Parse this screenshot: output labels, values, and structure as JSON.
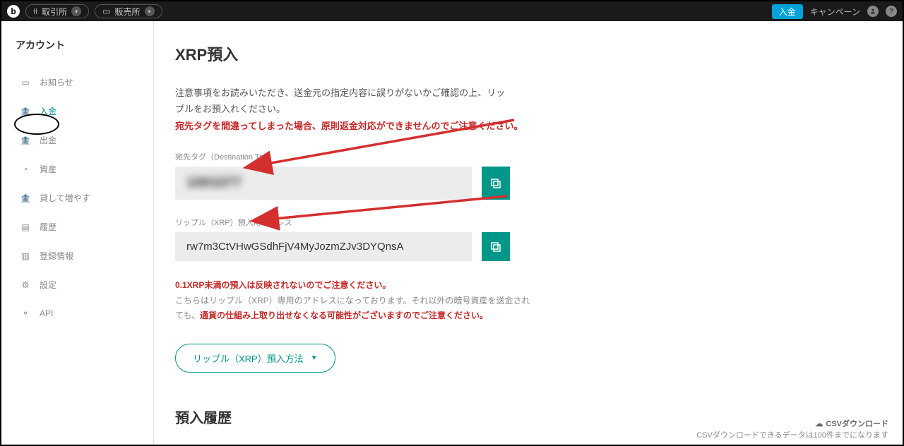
{
  "topbar": {
    "exchange_label": "取引所",
    "store_label": "販売所",
    "deposit_button": "入金",
    "campaign_link": "キャンペーン"
  },
  "sidebar": {
    "title": "アカウント",
    "items": [
      {
        "icon": "message",
        "label": "お知らせ"
      },
      {
        "icon": "bank",
        "label": "入金",
        "active": true
      },
      {
        "icon": "bank-out",
        "label": "出金"
      },
      {
        "icon": "pie",
        "label": "資産"
      },
      {
        "icon": "bank-plus",
        "label": "貸して増やす"
      },
      {
        "icon": "doc",
        "label": "履歴"
      },
      {
        "icon": "reg",
        "label": "登録情報"
      },
      {
        "icon": "gear",
        "label": "設定"
      },
      {
        "icon": "api",
        "label": "API"
      }
    ]
  },
  "main": {
    "title": "XRP預入",
    "intro": "注意事項をお読みいただき、送金元の指定内容に誤りがないかご確認の上、リップルをお預入れください。",
    "warn": "宛先タグを間違ってしまった場合、原則返金対応ができませんのでご注意ください。",
    "tag_label": "宛先タグ（Destination Tag）",
    "tag_value": "1001077",
    "addr_label": "リップル（XRP）預入用アドレス",
    "addr_value": "rw7m3CtVHwGSdhFjV4MyJozmZJv3DYQnsA",
    "note1": "0.1XRP未満の預入は反映されないのでご注意ください。",
    "note2_a": "こちらはリップル（XRP）専用のアドレスになっております。それ以外の暗号資産を送金されても、",
    "note2_b": "通貨の仕組み上取り出せなくなる可能性がございますのでご注意ください。",
    "method_button": "リップル（XRP）預入方法",
    "history_title": "預入履歴",
    "csv_download": "CSVダウンロード",
    "csv_note": "CSVダウンロードできるデータは100件までになります"
  }
}
